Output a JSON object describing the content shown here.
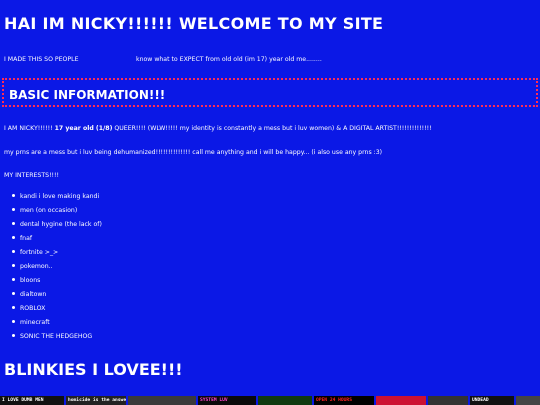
{
  "header": {
    "title": "HAI IM NICKY!!!!!! WELCOME TO MY SITE"
  },
  "intro": {
    "left": "I MADE THIS SO PEOPLE",
    "right": "know what to EXPECT from old old (im 17) year old me........"
  },
  "basic_info": {
    "heading": "BASIC INFORMATION!!!",
    "about_pre": "I AM NICKY!!!!!! ",
    "about_bold": "17 year old (1/8)",
    "about_post": " QUEER!!!! (WLW!!!!! my identity is constantly a mess but i luv women) & A DIGITAL ARTIST!!!!!!!!!!!!!!",
    "prns": "my prns are a mess but i luv being dehumanized!!!!!!!!!!!!!! call me anything and i will be happy... (i also use any prns :3)",
    "interests_heading": "MY INTERESTS!!!!",
    "interests": [
      "kandi i love making kandi",
      "men (on occasion)",
      "dental hygine (the lack of)",
      "fnaf",
      "fortnite >_>",
      "pokemon..",
      "bloons",
      "dialtown",
      "ROBLOX",
      "minecraft",
      "SONIC THE HEDGEHOG"
    ]
  },
  "blinkies": {
    "heading": "BLINKIES I LOVEE!!!",
    "items": [
      {
        "text": "I LOVE DUMB MEN",
        "bg": "#111111",
        "fg": "#ffffff"
      },
      {
        "text": "homicide is the answer",
        "bg": "#222222",
        "fg": "#ffffff"
      },
      {
        "text": "",
        "bg": "#3a3a3a",
        "fg": "#ffffff"
      },
      {
        "text": "SYSTEM LUV",
        "bg": "#0a0a0a",
        "fg": "#ff44cc"
      },
      {
        "text": "",
        "bg": "#103a10",
        "fg": "#66ff66"
      },
      {
        "text": "OPEN 24 HOURS",
        "bg": "#000000",
        "fg": "#ff2222"
      },
      {
        "text": "",
        "bg": "#cc1133",
        "fg": "#ffffff"
      },
      {
        "text": "",
        "bg": "#333333",
        "fg": "#ffffff"
      },
      {
        "text": "UNDEAD",
        "bg": "#111111",
        "fg": "#ffffff"
      },
      {
        "text": "",
        "bg": "#444444",
        "fg": "#ffffff"
      }
    ]
  }
}
